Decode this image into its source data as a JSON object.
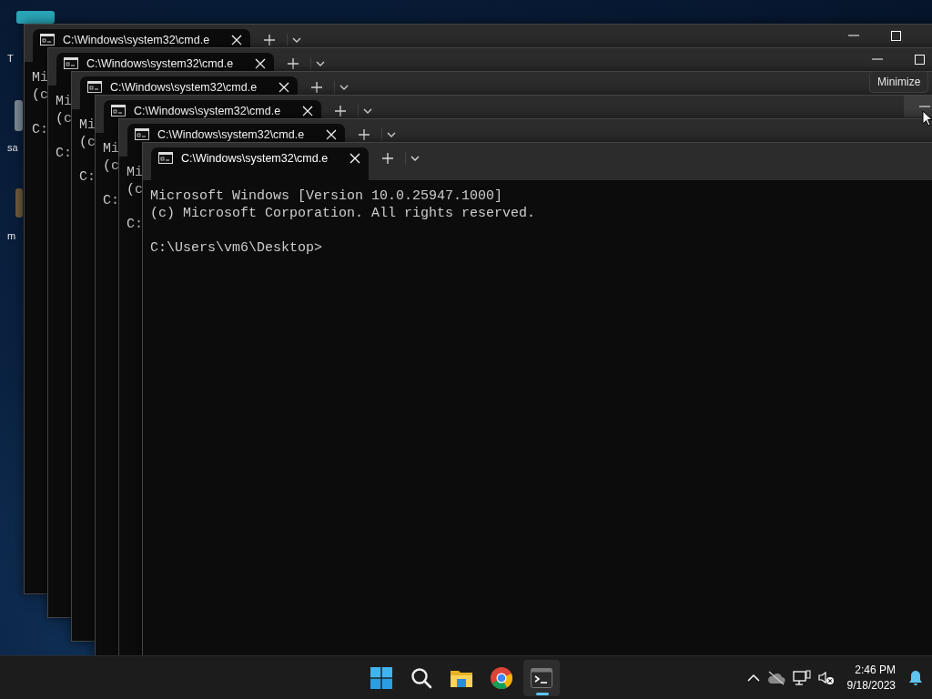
{
  "desktop": {
    "icons": [
      {
        "label": "T"
      },
      {
        "label": "sa"
      },
      {
        "label": "m"
      }
    ]
  },
  "windows": [
    {
      "tab_title": "C:\\Windows\\system32\\cmd.e",
      "banner": [
        "Mi",
        "(c"
      ],
      "prompt": "C:",
      "caption_buttons": [
        {
          "kind": "minimize",
          "hovered": false
        },
        {
          "kind": "maximize",
          "hovered": false
        }
      ]
    },
    {
      "tab_title": "C:\\Windows\\system32\\cmd.e",
      "banner": [
        "Mi",
        "(c"
      ],
      "prompt": "C:",
      "caption_buttons": [
        {
          "kind": "minimize",
          "hovered": false
        },
        {
          "kind": "maximize",
          "hovered": false
        }
      ]
    },
    {
      "tab_title": "C:\\Windows\\system32\\cmd.e",
      "banner": [
        "Mi",
        "(c"
      ],
      "prompt": "C:"
    },
    {
      "tab_title": "C:\\Windows\\system32\\cmd.e",
      "banner": [
        "Mi",
        "(c"
      ],
      "prompt": "C:",
      "caption_buttons": [
        {
          "kind": "minimize",
          "hovered": true
        }
      ]
    },
    {
      "tab_title": "C:\\Windows\\system32\\cmd.e",
      "banner": [
        "Mi",
        "(c"
      ],
      "prompt": "C:"
    },
    {
      "tab_title": "C:\\Windows\\system32\\cmd.e",
      "banner": [
        "Microsoft Windows [Version 10.0.25947.1000]",
        "(c) Microsoft Corporation. All rights reserved."
      ],
      "prompt": "C:\\Users\\vm6\\Desktop>"
    }
  ],
  "tooltip": "Minimize",
  "taskbar": {
    "apps": [
      {
        "kind": "start",
        "active": false
      },
      {
        "kind": "search",
        "active": false
      },
      {
        "kind": "explorer",
        "active": false
      },
      {
        "kind": "chrome",
        "active": false
      },
      {
        "kind": "terminal",
        "active": true
      }
    ],
    "clock": {
      "time": "2:46 PM",
      "date": "9/18/2023"
    }
  }
}
